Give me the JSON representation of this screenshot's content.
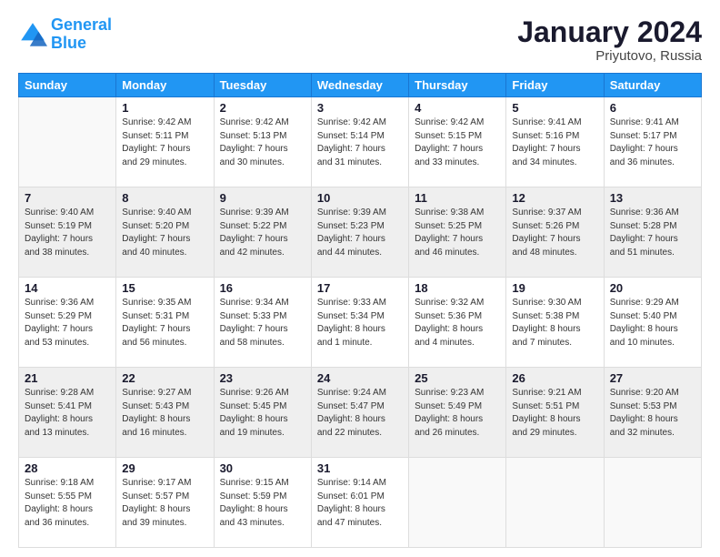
{
  "header": {
    "logo_line1": "General",
    "logo_line2": "Blue",
    "month": "January 2024",
    "location": "Priyutovo, Russia"
  },
  "weekdays": [
    "Sunday",
    "Monday",
    "Tuesday",
    "Wednesday",
    "Thursday",
    "Friday",
    "Saturday"
  ],
  "weeks": [
    [
      {
        "day": "",
        "info": ""
      },
      {
        "day": "1",
        "info": "Sunrise: 9:42 AM\nSunset: 5:11 PM\nDaylight: 7 hours\nand 29 minutes."
      },
      {
        "day": "2",
        "info": "Sunrise: 9:42 AM\nSunset: 5:13 PM\nDaylight: 7 hours\nand 30 minutes."
      },
      {
        "day": "3",
        "info": "Sunrise: 9:42 AM\nSunset: 5:14 PM\nDaylight: 7 hours\nand 31 minutes."
      },
      {
        "day": "4",
        "info": "Sunrise: 9:42 AM\nSunset: 5:15 PM\nDaylight: 7 hours\nand 33 minutes."
      },
      {
        "day": "5",
        "info": "Sunrise: 9:41 AM\nSunset: 5:16 PM\nDaylight: 7 hours\nand 34 minutes."
      },
      {
        "day": "6",
        "info": "Sunrise: 9:41 AM\nSunset: 5:17 PM\nDaylight: 7 hours\nand 36 minutes."
      }
    ],
    [
      {
        "day": "7",
        "info": "Sunrise: 9:40 AM\nSunset: 5:19 PM\nDaylight: 7 hours\nand 38 minutes."
      },
      {
        "day": "8",
        "info": "Sunrise: 9:40 AM\nSunset: 5:20 PM\nDaylight: 7 hours\nand 40 minutes."
      },
      {
        "day": "9",
        "info": "Sunrise: 9:39 AM\nSunset: 5:22 PM\nDaylight: 7 hours\nand 42 minutes."
      },
      {
        "day": "10",
        "info": "Sunrise: 9:39 AM\nSunset: 5:23 PM\nDaylight: 7 hours\nand 44 minutes."
      },
      {
        "day": "11",
        "info": "Sunrise: 9:38 AM\nSunset: 5:25 PM\nDaylight: 7 hours\nand 46 minutes."
      },
      {
        "day": "12",
        "info": "Sunrise: 9:37 AM\nSunset: 5:26 PM\nDaylight: 7 hours\nand 48 minutes."
      },
      {
        "day": "13",
        "info": "Sunrise: 9:36 AM\nSunset: 5:28 PM\nDaylight: 7 hours\nand 51 minutes."
      }
    ],
    [
      {
        "day": "14",
        "info": "Sunrise: 9:36 AM\nSunset: 5:29 PM\nDaylight: 7 hours\nand 53 minutes."
      },
      {
        "day": "15",
        "info": "Sunrise: 9:35 AM\nSunset: 5:31 PM\nDaylight: 7 hours\nand 56 minutes."
      },
      {
        "day": "16",
        "info": "Sunrise: 9:34 AM\nSunset: 5:33 PM\nDaylight: 7 hours\nand 58 minutes."
      },
      {
        "day": "17",
        "info": "Sunrise: 9:33 AM\nSunset: 5:34 PM\nDaylight: 8 hours\nand 1 minute."
      },
      {
        "day": "18",
        "info": "Sunrise: 9:32 AM\nSunset: 5:36 PM\nDaylight: 8 hours\nand 4 minutes."
      },
      {
        "day": "19",
        "info": "Sunrise: 9:30 AM\nSunset: 5:38 PM\nDaylight: 8 hours\nand 7 minutes."
      },
      {
        "day": "20",
        "info": "Sunrise: 9:29 AM\nSunset: 5:40 PM\nDaylight: 8 hours\nand 10 minutes."
      }
    ],
    [
      {
        "day": "21",
        "info": "Sunrise: 9:28 AM\nSunset: 5:41 PM\nDaylight: 8 hours\nand 13 minutes."
      },
      {
        "day": "22",
        "info": "Sunrise: 9:27 AM\nSunset: 5:43 PM\nDaylight: 8 hours\nand 16 minutes."
      },
      {
        "day": "23",
        "info": "Sunrise: 9:26 AM\nSunset: 5:45 PM\nDaylight: 8 hours\nand 19 minutes."
      },
      {
        "day": "24",
        "info": "Sunrise: 9:24 AM\nSunset: 5:47 PM\nDaylight: 8 hours\nand 22 minutes."
      },
      {
        "day": "25",
        "info": "Sunrise: 9:23 AM\nSunset: 5:49 PM\nDaylight: 8 hours\nand 26 minutes."
      },
      {
        "day": "26",
        "info": "Sunrise: 9:21 AM\nSunset: 5:51 PM\nDaylight: 8 hours\nand 29 minutes."
      },
      {
        "day": "27",
        "info": "Sunrise: 9:20 AM\nSunset: 5:53 PM\nDaylight: 8 hours\nand 32 minutes."
      }
    ],
    [
      {
        "day": "28",
        "info": "Sunrise: 9:18 AM\nSunset: 5:55 PM\nDaylight: 8 hours\nand 36 minutes."
      },
      {
        "day": "29",
        "info": "Sunrise: 9:17 AM\nSunset: 5:57 PM\nDaylight: 8 hours\nand 39 minutes."
      },
      {
        "day": "30",
        "info": "Sunrise: 9:15 AM\nSunset: 5:59 PM\nDaylight: 8 hours\nand 43 minutes."
      },
      {
        "day": "31",
        "info": "Sunrise: 9:14 AM\nSunset: 6:01 PM\nDaylight: 8 hours\nand 47 minutes."
      },
      {
        "day": "",
        "info": ""
      },
      {
        "day": "",
        "info": ""
      },
      {
        "day": "",
        "info": ""
      }
    ]
  ]
}
